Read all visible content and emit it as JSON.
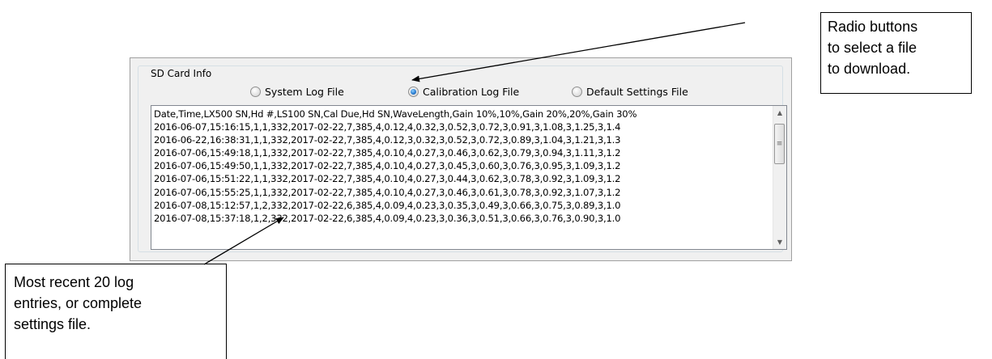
{
  "sd_card_group": {
    "title": "SD Card Info",
    "radios": [
      {
        "label": "System Log File",
        "checked": false
      },
      {
        "label": "Calibration Log File",
        "checked": true
      },
      {
        "label": "Default Settings File",
        "checked": false
      }
    ]
  },
  "log_box": {
    "lines": [
      "Date,Time,LX500 SN,Hd #,LS100 SN,Cal Due,Hd SN,WaveLength,Gain 10%,10%,Gain 20%,20%,Gain 30%",
      "2016-06-07,15:16:15,1,1,332,2017-02-22,7,385,4,0.12,4,0.32,3,0.52,3,0.72,3,0.91,3,1.08,3,1.25,3,1.4",
      "2016-06-22,16:38:31,1,1,332,2017-02-22,7,385,4,0.12,3,0.32,3,0.52,3,0.72,3,0.89,3,1.04,3,1.21,3,1.3",
      "2016-07-06,15:49:18,1,1,332,2017-02-22,7,385,4,0.10,4,0.27,3,0.46,3,0.62,3,0.79,3,0.94,3,1.11,3,1.2",
      "2016-07-06,15:49:50,1,1,332,2017-02-22,7,385,4,0.10,4,0.27,3,0.45,3,0.60,3,0.76,3,0.95,3,1.09,3,1.2",
      "2016-07-06,15:51:22,1,1,332,2017-02-22,7,385,4,0.10,4,0.27,3,0.44,3,0.62,3,0.78,3,0.92,3,1.09,3,1.2",
      "2016-07-06,15:55:25,1,1,332,2017-02-22,7,385,4,0.10,4,0.27,3,0.46,3,0.61,3,0.78,3,0.92,3,1.07,3,1.2",
      "2016-07-08,15:12:57,1,2,332,2017-02-22,6,385,4,0.09,4,0.23,3,0.35,3,0.49,3,0.66,3,0.75,3,0.89,3,1.0",
      "2016-07-08,15:37:18,1,2,332,2017-02-22,6,385,4,0.09,4,0.23,3,0.36,3,0.51,3,0.66,3,0.76,3,0.90,3,1.0"
    ]
  },
  "callouts": {
    "radio_note": [
      "Radio buttons",
      "to select a file",
      "to download."
    ],
    "log_note": [
      "Most recent 20 log",
      "entries, or complete",
      "settings file."
    ]
  },
  "icons": {
    "scroll_up": "▲",
    "scroll_down": "▼",
    "thumb_grip": "≡"
  }
}
